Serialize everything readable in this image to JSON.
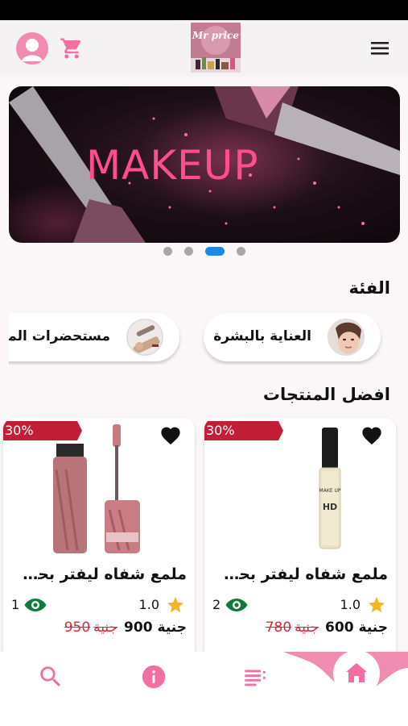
{
  "colors": {
    "accent": "#f26fa4",
    "brand_pink": "#f08cb0",
    "badge_red": "#c21e37",
    "old_price_red": "#e1223c",
    "active_dot": "#1e88e5",
    "star": "#f2b71e",
    "eye_green": "#0f7a3a"
  },
  "header": {
    "logo_text": "Mr price",
    "icons": [
      "user-avatar-icon",
      "cart-icon",
      "hamburger-menu-icon"
    ]
  },
  "banner": {
    "title": "MAKEUP",
    "carousel": {
      "count": 4,
      "active_index": 2
    }
  },
  "categories": {
    "title": "الفئة",
    "items": [
      {
        "label": "العناية بالبشرة",
        "icon": "face-thumb"
      },
      {
        "label": "مستحضرات المكياج",
        "icon": "makeup-thumb"
      }
    ]
  },
  "products": {
    "title": "افضل المنتجات",
    "items": [
      {
        "name": "ملمع شفاه ليفتر بحم...",
        "discount": "30%",
        "rating": "1.0",
        "views": "2",
        "price": "600",
        "currency": "جنية",
        "old_price": "780",
        "old_currency": "جنية",
        "image": "concealer-icon"
      },
      {
        "name": "ملمع شفاه ليفتر بحم...",
        "discount": "30%",
        "rating": "1.0",
        "views": "1",
        "price": "900",
        "currency": "جنية",
        "old_price": "950",
        "old_currency": "جنية",
        "image": "lip-gloss-icon"
      }
    ]
  },
  "bottom_nav": {
    "items": [
      "search-icon",
      "info-icon",
      "list-icon",
      "home-icon"
    ],
    "active": "home-icon"
  }
}
